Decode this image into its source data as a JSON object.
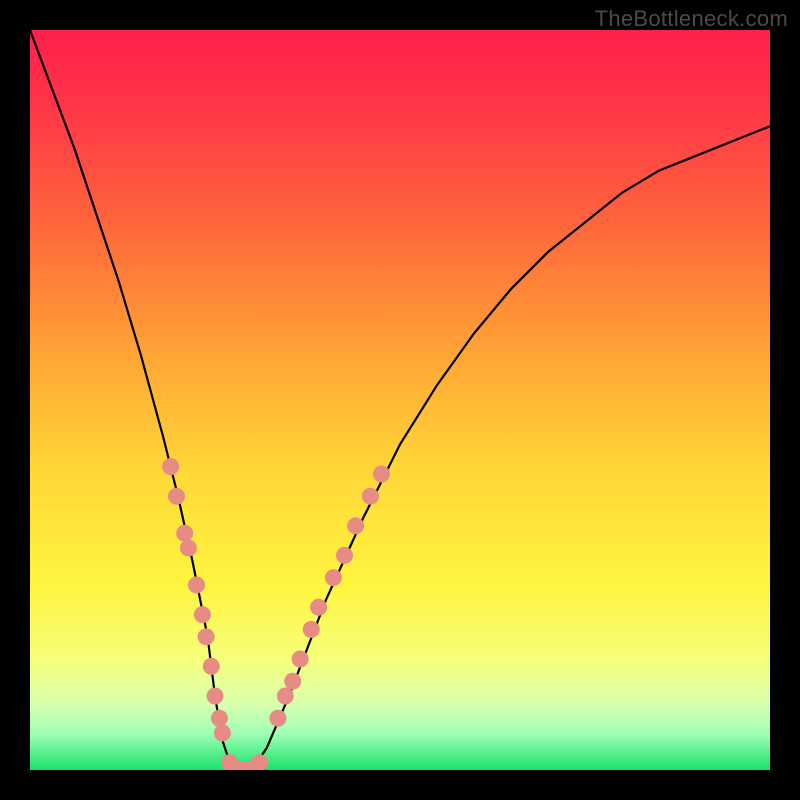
{
  "watermark": "TheBottleneck.com",
  "colors": {
    "frame_bg": "#000000",
    "curve_stroke": "#000000",
    "points_fill": "#e78b85",
    "gradient_stops": [
      {
        "offset": 0.0,
        "color": "#ff1f4b"
      },
      {
        "offset": 0.12,
        "color": "#ff3a46"
      },
      {
        "offset": 0.28,
        "color": "#ff6c3a"
      },
      {
        "offset": 0.45,
        "color": "#ffa935"
      },
      {
        "offset": 0.6,
        "color": "#ffd838"
      },
      {
        "offset": 0.75,
        "color": "#fff53f"
      },
      {
        "offset": 0.85,
        "color": "#f6ff7a"
      },
      {
        "offset": 0.91,
        "color": "#d9ffae"
      },
      {
        "offset": 0.95,
        "color": "#9fffb5"
      },
      {
        "offset": 1.0,
        "color": "#19e36a"
      }
    ]
  },
  "chart_data": {
    "type": "line",
    "title": "",
    "xlabel": "",
    "ylabel": "",
    "xlim": [
      0,
      100
    ],
    "ylim": [
      0,
      100
    ],
    "series": [
      {
        "name": "bottleneck-curve",
        "x": [
          0,
          3,
          6,
          9,
          12,
          15,
          18,
          20,
          22,
          24,
          25,
          26,
          27,
          28,
          30,
          32,
          35,
          40,
          45,
          50,
          55,
          60,
          65,
          70,
          75,
          80,
          85,
          90,
          95,
          100
        ],
        "y": [
          100,
          92,
          84,
          75,
          66,
          56,
          45,
          37,
          28,
          18,
          10,
          4,
          1,
          0,
          0,
          3,
          10,
          23,
          34,
          44,
          52,
          59,
          65,
          70,
          74,
          78,
          81,
          83,
          85,
          87
        ]
      }
    ],
    "points": [
      {
        "name": "left-cluster",
        "x": 19.0,
        "y": 41
      },
      {
        "name": "left-cluster",
        "x": 19.8,
        "y": 37
      },
      {
        "name": "left-cluster",
        "x": 20.9,
        "y": 32
      },
      {
        "name": "left-cluster",
        "x": 21.4,
        "y": 30
      },
      {
        "name": "left-cluster",
        "x": 22.5,
        "y": 25
      },
      {
        "name": "left-cluster",
        "x": 23.3,
        "y": 21
      },
      {
        "name": "left-cluster",
        "x": 23.8,
        "y": 18
      },
      {
        "name": "left-cluster",
        "x": 24.5,
        "y": 14
      },
      {
        "name": "left-cluster",
        "x": 25.0,
        "y": 10
      },
      {
        "name": "left-cluster",
        "x": 25.6,
        "y": 7
      },
      {
        "name": "left-cluster",
        "x": 26.0,
        "y": 5
      },
      {
        "name": "bottom",
        "x": 27.0,
        "y": 1
      },
      {
        "name": "bottom",
        "x": 28.0,
        "y": 0
      },
      {
        "name": "bottom",
        "x": 29.0,
        "y": 0
      },
      {
        "name": "bottom",
        "x": 30.0,
        "y": 0
      },
      {
        "name": "bottom",
        "x": 31.0,
        "y": 1
      },
      {
        "name": "right-cluster",
        "x": 33.5,
        "y": 7
      },
      {
        "name": "right-cluster",
        "x": 34.5,
        "y": 10
      },
      {
        "name": "right-cluster",
        "x": 35.5,
        "y": 12
      },
      {
        "name": "right-cluster",
        "x": 36.5,
        "y": 15
      },
      {
        "name": "right-cluster",
        "x": 38.0,
        "y": 19
      },
      {
        "name": "right-cluster",
        "x": 39.0,
        "y": 22
      },
      {
        "name": "right-cluster",
        "x": 41.0,
        "y": 26
      },
      {
        "name": "right-cluster",
        "x": 42.5,
        "y": 29
      },
      {
        "name": "right-cluster",
        "x": 44.0,
        "y": 33
      },
      {
        "name": "right-cluster",
        "x": 46.0,
        "y": 37
      },
      {
        "name": "right-cluster",
        "x": 47.5,
        "y": 40
      }
    ]
  }
}
